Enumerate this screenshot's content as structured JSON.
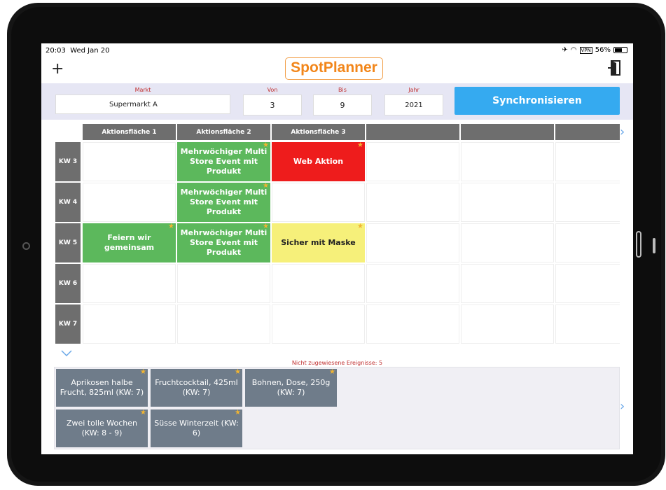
{
  "status": {
    "time": "20:03",
    "date": "Wed Jan 20",
    "battery": "56%",
    "vpn": "VPN"
  },
  "app": {
    "logo_text": "SpotPlanner",
    "add_icon": "plus-icon",
    "exit_icon": "exit-icon"
  },
  "filters": {
    "markt_label": "Markt",
    "markt_value": "Supermarkt  A",
    "von_label": "Von",
    "von_value": "3",
    "bis_label": "Bis",
    "bis_value": "9",
    "jahr_label": "Jahr",
    "jahr_value": "2021",
    "sync_label": "Synchronisieren"
  },
  "grid": {
    "columns": [
      "Aktionsfläche 1",
      "Aktionsfläche 2",
      "Aktionsfläche 3",
      "",
      "",
      ""
    ],
    "rows": [
      "KW 3",
      "KW 4",
      "KW 5",
      "KW 6",
      "KW 7"
    ],
    "events": [
      {
        "row": 0,
        "col": 1,
        "text": "Mehrwöchiger Multi Store Event mit Produkt",
        "color": "#5cb85c",
        "text_color": "#ffffff"
      },
      {
        "row": 0,
        "col": 2,
        "text": "Web Aktion",
        "color": "#ee1c1c",
        "text_color": "#ffffff"
      },
      {
        "row": 1,
        "col": 1,
        "text": "Mehrwöchiger Multi Store Event mit Produkt",
        "color": "#5cb85c",
        "text_color": "#ffffff"
      },
      {
        "row": 2,
        "col": 0,
        "text": "Feiern wir gemeinsam",
        "color": "#5cb85c",
        "text_color": "#ffffff"
      },
      {
        "row": 2,
        "col": 1,
        "text": "Mehrwöchiger Multi Store Event mit Produkt",
        "color": "#5cb85c",
        "text_color": "#ffffff"
      },
      {
        "row": 2,
        "col": 2,
        "text": "Sicher mit Maske",
        "color": "#f6f07a",
        "text_color": "#222222"
      }
    ]
  },
  "unassigned": {
    "title": "Nicht zugewiesene Ereignisse: 5",
    "cards": [
      {
        "text": "Aprikosen halbe Frucht, 825ml (KW: 7)"
      },
      {
        "text": "Fruchtcocktail, 425ml (KW: 7)"
      },
      {
        "text": "Bohnen, Dose, 250g (KW: 7)"
      },
      {
        "text": "Zwei tolle Wochen (KW: 8 - 9)"
      },
      {
        "text": "Süsse Winterzeit (KW: 6)"
      }
    ]
  },
  "colors": {
    "accent": "#35aaf0",
    "logo": "#f2861a",
    "header_gray": "#6e6e6e",
    "card_gray": "#6f7c8a"
  }
}
